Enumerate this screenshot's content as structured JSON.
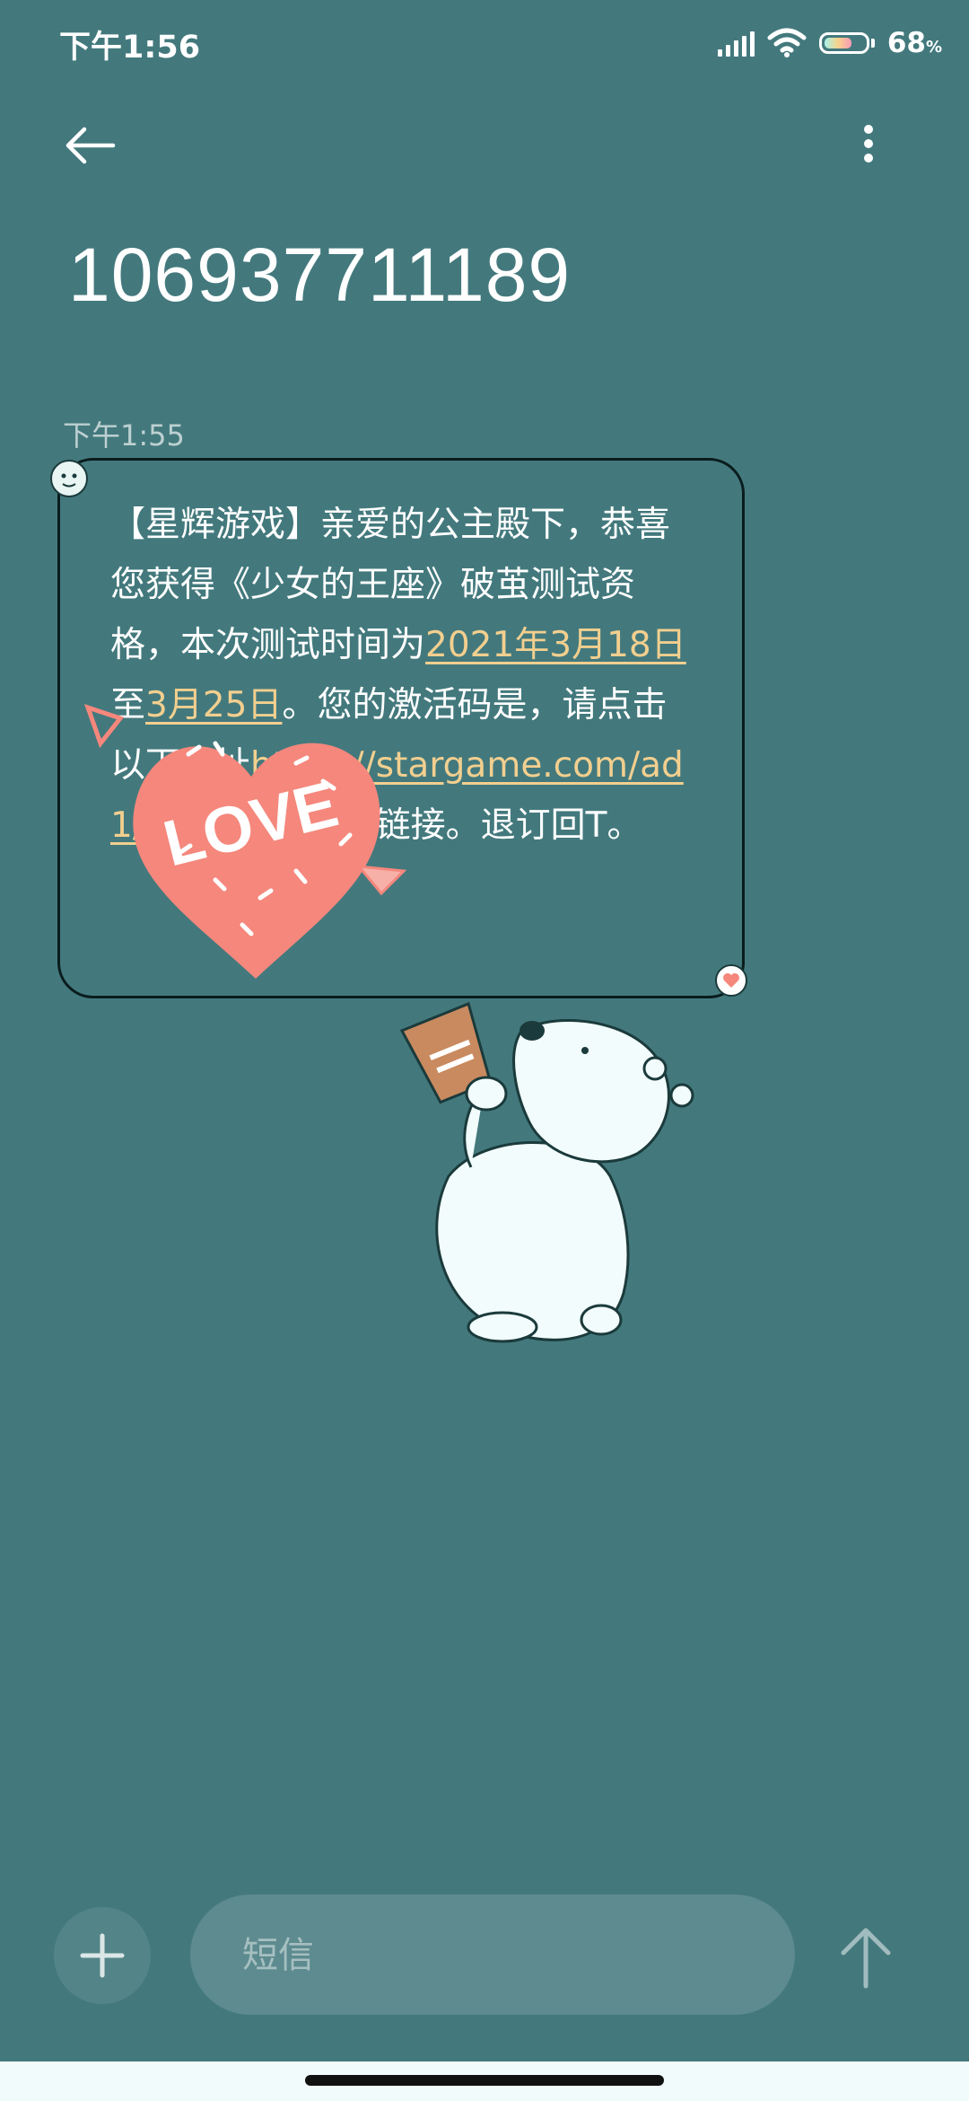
{
  "status_bar": {
    "time": "下午1:56",
    "battery_pct": "68",
    "battery_sign": "%",
    "battery_level": 0.68,
    "icons": [
      "signal-icon",
      "wifi-icon",
      "battery-icon"
    ]
  },
  "header": {
    "title": "106937711189",
    "back_icon": "back-arrow-icon",
    "more_icon": "more-vertical-icon"
  },
  "message": {
    "timestamp": "下午1:55",
    "text_part1": "【星辉游戏】亲爱的公主殿下，恭喜您获得《少女的王座》破茧测试资格，本次测试时间为",
    "link_date1": "2021年3月18日",
    "text_part2": "至",
    "link_date2": "3月25日",
    "text_part3": "。您的激活码是",
    "text_part4": "，请点击以下网址",
    "link_url": "https://stargame.com/ad1/sndw",
    "text_part5": "获取下载链接。退订回T。",
    "sticker_text": "LOVE"
  },
  "composer": {
    "placeholder": "短信",
    "add_icon": "plus-icon",
    "send_icon": "send-arrow-icon"
  },
  "colors": {
    "background": "#43797d",
    "link": "#f2cf8f",
    "heart": "#f5877c"
  }
}
